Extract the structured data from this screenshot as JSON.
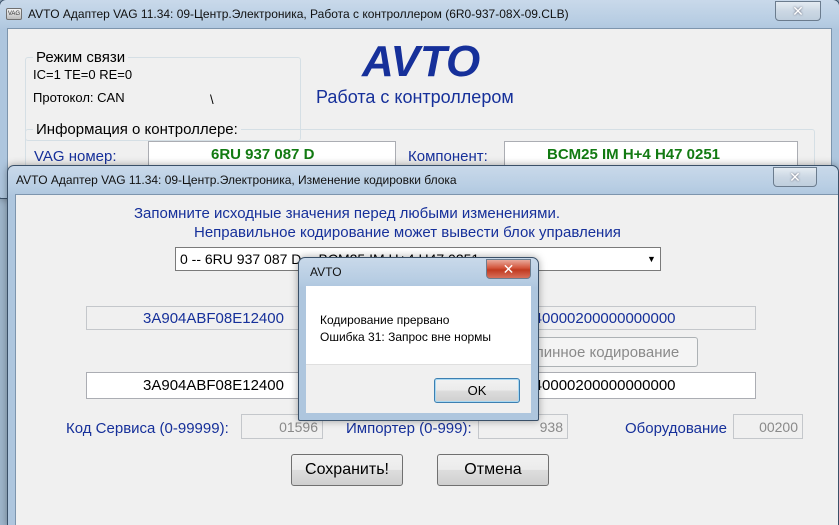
{
  "main_window": {
    "title": "AVTO Адаптер VAG 11.34: 09-Центр.Электроника,  Работа с контроллером (6R0-937-08X-09.CLB)",
    "icon_text": "VAG",
    "close_label": "✕",
    "mode_group": {
      "caption": "Режим связи",
      "line1": "IC=1  TE=0   RE=0",
      "line2": "Протокол: CAN",
      "spinner": "\\"
    },
    "logo": "AVTO",
    "subtitle": "Работа с контроллером",
    "info_group": {
      "caption": "Информация о контроллере:",
      "vag_label": "VAG номер:",
      "vag_value": "6RU 937 087 D",
      "component_label": "Компонент:",
      "component_value": "BCM25 IM H+4  H47 0251"
    }
  },
  "coding_window": {
    "title": "AVTO Адаптер VAG 11.34: 09-Центр.Электроника,  Изменение кодировки блока",
    "close_label": "✕",
    "warning_line1": "Запомните исходные значения перед любыми изменениями.",
    "warning_line2": "Неправильное кодирование может вывести блок управления",
    "combo_value": "0 -- 6RU 937 087 D -- BCM25 IM H+4  H47 0251",
    "combo_arrow": "▼",
    "coding_current_left": "3A904ABF08E12400",
    "coding_current_right": "0040000200000000000",
    "long_coding_button": "Длинное кодирование",
    "coding_new_left": "3A904ABF08E12400",
    "coding_new_right": "0040000200000000000",
    "service_label": "Код Сервиса (0-99999):",
    "service_value": "01596",
    "importer_label": "Импортер (0-999):",
    "importer_value": "938",
    "equipment_label": "Оборудование",
    "equipment_value": "00200",
    "save_button": "Сохранить!",
    "cancel_button": "Отмена"
  },
  "dialog": {
    "title": "AVTO",
    "close_label": "✕",
    "message_line1": "Кодирование прервано",
    "message_line2": "Ошибка 31: Запрос вне нормы",
    "ok_button": "OK"
  },
  "colors": {
    "accent_blue": "#16309a",
    "value_green": "#127a12",
    "close_red": "#c03a20"
  }
}
